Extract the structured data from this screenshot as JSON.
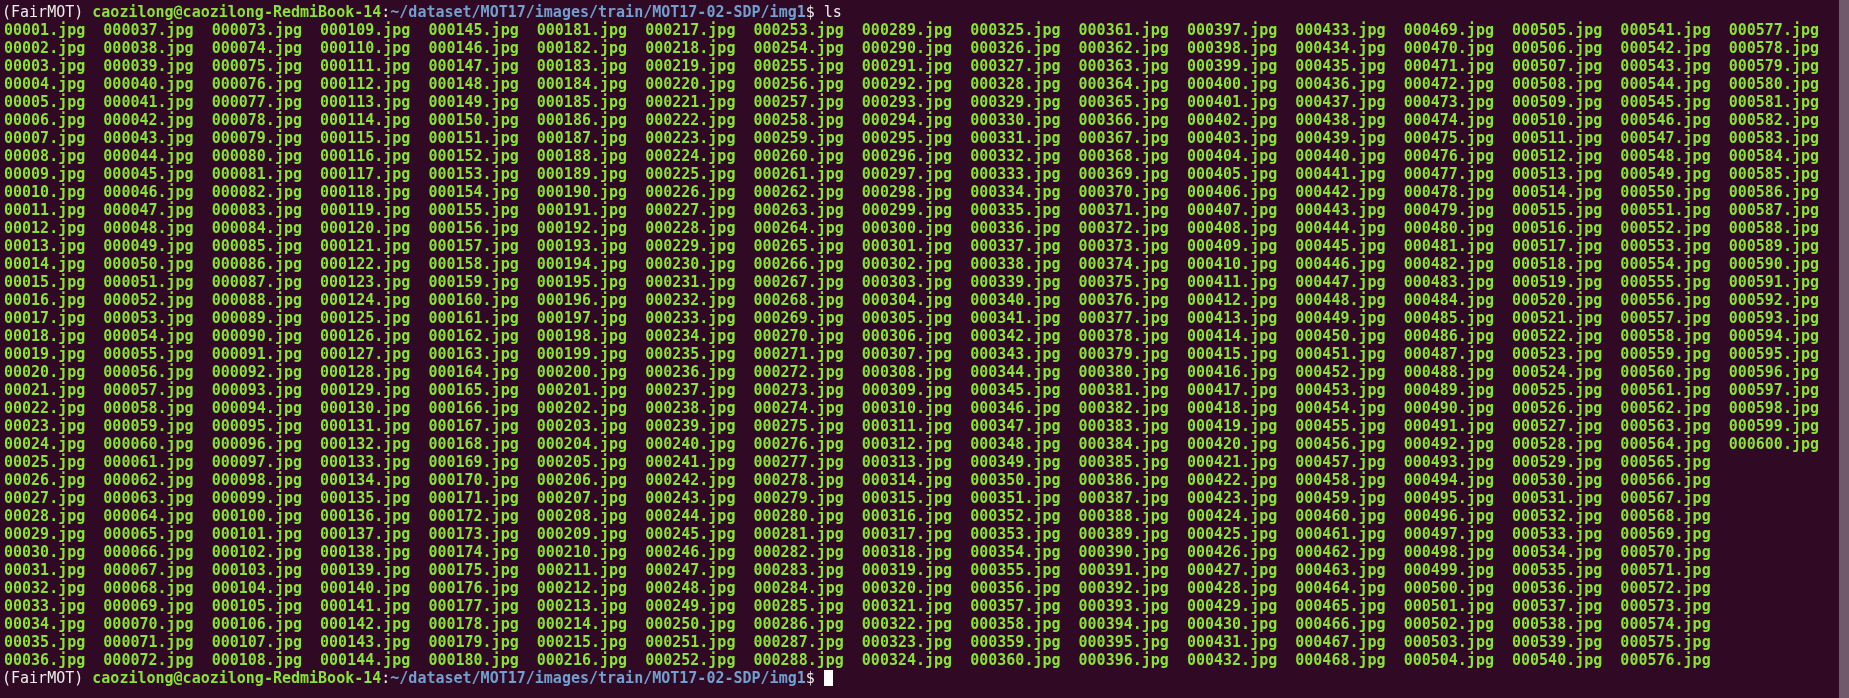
{
  "prompts": [
    {
      "env": "(FairMOT)",
      "user_host": "caozilong@caozilong-RedmiBook-14",
      "separator": ":",
      "path": "~/dataset/MOT17/images/train/MOT17-02-SDP/img1",
      "symbol": "$",
      "command": "ls",
      "cursor": false
    }
  ],
  "listing": {
    "columns": [
      [
        "00001.jpg",
        "00002.jpg",
        "00003.jpg",
        "00004.jpg",
        "00005.jpg",
        "00006.jpg",
        "00007.jpg",
        "00008.jpg",
        "00009.jpg",
        "00010.jpg",
        "00011.jpg",
        "00012.jpg",
        "00013.jpg",
        "00014.jpg",
        "00015.jpg",
        "00016.jpg",
        "00017.jpg",
        "00018.jpg",
        "00019.jpg",
        "00020.jpg",
        "00021.jpg",
        "00022.jpg",
        "00023.jpg",
        "00024.jpg",
        "00025.jpg",
        "00026.jpg",
        "00027.jpg",
        "00028.jpg",
        "00029.jpg",
        "00030.jpg",
        "00031.jpg",
        "00032.jpg",
        "00033.jpg",
        "00034.jpg",
        "00035.jpg",
        "00036.jpg"
      ],
      [
        "000037.jpg",
        "000038.jpg",
        "000039.jpg",
        "000040.jpg",
        "000041.jpg",
        "000042.jpg",
        "000043.jpg",
        "000044.jpg",
        "000045.jpg",
        "000046.jpg",
        "000047.jpg",
        "000048.jpg",
        "000049.jpg",
        "000050.jpg",
        "000051.jpg",
        "000052.jpg",
        "000053.jpg",
        "000054.jpg",
        "000055.jpg",
        "000056.jpg",
        "000057.jpg",
        "000058.jpg",
        "000059.jpg",
        "000060.jpg",
        "000061.jpg",
        "000062.jpg",
        "000063.jpg",
        "000064.jpg",
        "000065.jpg",
        "000066.jpg",
        "000067.jpg",
        "000068.jpg",
        "000069.jpg",
        "000070.jpg",
        "000071.jpg",
        "000072.jpg"
      ],
      [
        "000073.jpg",
        "000074.jpg",
        "000075.jpg",
        "000076.jpg",
        "000077.jpg",
        "000078.jpg",
        "000079.jpg",
        "000080.jpg",
        "000081.jpg",
        "000082.jpg",
        "000083.jpg",
        "000084.jpg",
        "000085.jpg",
        "000086.jpg",
        "000087.jpg",
        "000088.jpg",
        "000089.jpg",
        "000090.jpg",
        "000091.jpg",
        "000092.jpg",
        "000093.jpg",
        "000094.jpg",
        "000095.jpg",
        "000096.jpg",
        "000097.jpg",
        "000098.jpg",
        "000099.jpg",
        "000100.jpg",
        "000101.jpg",
        "000102.jpg",
        "000103.jpg",
        "000104.jpg",
        "000105.jpg",
        "000106.jpg",
        "000107.jpg",
        "000108.jpg"
      ],
      [
        "000109.jpg",
        "000110.jpg",
        "000111.jpg",
        "000112.jpg",
        "000113.jpg",
        "000114.jpg",
        "000115.jpg",
        "000116.jpg",
        "000117.jpg",
        "000118.jpg",
        "000119.jpg",
        "000120.jpg",
        "000121.jpg",
        "000122.jpg",
        "000123.jpg",
        "000124.jpg",
        "000125.jpg",
        "000126.jpg",
        "000127.jpg",
        "000128.jpg",
        "000129.jpg",
        "000130.jpg",
        "000131.jpg",
        "000132.jpg",
        "000133.jpg",
        "000134.jpg",
        "000135.jpg",
        "000136.jpg",
        "000137.jpg",
        "000138.jpg",
        "000139.jpg",
        "000140.jpg",
        "000141.jpg",
        "000142.jpg",
        "000143.jpg",
        "000144.jpg"
      ],
      [
        "000145.jpg",
        "000146.jpg",
        "000147.jpg",
        "000148.jpg",
        "000149.jpg",
        "000150.jpg",
        "000151.jpg",
        "000152.jpg",
        "000153.jpg",
        "000154.jpg",
        "000155.jpg",
        "000156.jpg",
        "000157.jpg",
        "000158.jpg",
        "000159.jpg",
        "000160.jpg",
        "000161.jpg",
        "000162.jpg",
        "000163.jpg",
        "000164.jpg",
        "000165.jpg",
        "000166.jpg",
        "000167.jpg",
        "000168.jpg",
        "000169.jpg",
        "000170.jpg",
        "000171.jpg",
        "000172.jpg",
        "000173.jpg",
        "000174.jpg",
        "000175.jpg",
        "000176.jpg",
        "000177.jpg",
        "000178.jpg",
        "000179.jpg",
        "000180.jpg"
      ],
      [
        "000181.jpg",
        "000182.jpg",
        "000183.jpg",
        "000184.jpg",
        "000185.jpg",
        "000186.jpg",
        "000187.jpg",
        "000188.jpg",
        "000189.jpg",
        "000190.jpg",
        "000191.jpg",
        "000192.jpg",
        "000193.jpg",
        "000194.jpg",
        "000195.jpg",
        "000196.jpg",
        "000197.jpg",
        "000198.jpg",
        "000199.jpg",
        "000200.jpg",
        "000201.jpg",
        "000202.jpg",
        "000203.jpg",
        "000204.jpg",
        "000205.jpg",
        "000206.jpg",
        "000207.jpg",
        "000208.jpg",
        "000209.jpg",
        "000210.jpg",
        "000211.jpg",
        "000212.jpg",
        "000213.jpg",
        "000214.jpg",
        "000215.jpg",
        "000216.jpg"
      ],
      [
        "000217.jpg",
        "000218.jpg",
        "000219.jpg",
        "000220.jpg",
        "000221.jpg",
        "000222.jpg",
        "000223.jpg",
        "000224.jpg",
        "000225.jpg",
        "000226.jpg",
        "000227.jpg",
        "000228.jpg",
        "000229.jpg",
        "000230.jpg",
        "000231.jpg",
        "000232.jpg",
        "000233.jpg",
        "000234.jpg",
        "000235.jpg",
        "000236.jpg",
        "000237.jpg",
        "000238.jpg",
        "000239.jpg",
        "000240.jpg",
        "000241.jpg",
        "000242.jpg",
        "000243.jpg",
        "000244.jpg",
        "000245.jpg",
        "000246.jpg",
        "000247.jpg",
        "000248.jpg",
        "000249.jpg",
        "000250.jpg",
        "000251.jpg",
        "000252.jpg"
      ],
      [
        "000253.jpg",
        "000254.jpg",
        "000255.jpg",
        "000256.jpg",
        "000257.jpg",
        "000258.jpg",
        "000259.jpg",
        "000260.jpg",
        "000261.jpg",
        "000262.jpg",
        "000263.jpg",
        "000264.jpg",
        "000265.jpg",
        "000266.jpg",
        "000267.jpg",
        "000268.jpg",
        "000269.jpg",
        "000270.jpg",
        "000271.jpg",
        "000272.jpg",
        "000273.jpg",
        "000274.jpg",
        "000275.jpg",
        "000276.jpg",
        "000277.jpg",
        "000278.jpg",
        "000279.jpg",
        "000280.jpg",
        "000281.jpg",
        "000282.jpg",
        "000283.jpg",
        "000284.jpg",
        "000285.jpg",
        "000286.jpg",
        "000287.jpg",
        "000288.jpg"
      ],
      [
        "000289.jpg",
        "000290.jpg",
        "000291.jpg",
        "000292.jpg",
        "000293.jpg",
        "000294.jpg",
        "000295.jpg",
        "000296.jpg",
        "000297.jpg",
        "000298.jpg",
        "000299.jpg",
        "000300.jpg",
        "000301.jpg",
        "000302.jpg",
        "000303.jpg",
        "000304.jpg",
        "000305.jpg",
        "000306.jpg",
        "000307.jpg",
        "000308.jpg",
        "000309.jpg",
        "000310.jpg",
        "000311.jpg",
        "000312.jpg",
        "000313.jpg",
        "000314.jpg",
        "000315.jpg",
        "000316.jpg",
        "000317.jpg",
        "000318.jpg",
        "000319.jpg",
        "000320.jpg",
        "000321.jpg",
        "000322.jpg",
        "000323.jpg",
        "000324.jpg"
      ],
      [
        "000325.jpg",
        "000326.jpg",
        "000327.jpg",
        "000328.jpg",
        "000329.jpg",
        "000330.jpg",
        "000331.jpg",
        "000332.jpg",
        "000333.jpg",
        "000334.jpg",
        "000335.jpg",
        "000336.jpg",
        "000337.jpg",
        "000338.jpg",
        "000339.jpg",
        "000340.jpg",
        "000341.jpg",
        "000342.jpg",
        "000343.jpg",
        "000344.jpg",
        "000345.jpg",
        "000346.jpg",
        "000347.jpg",
        "000348.jpg",
        "000349.jpg",
        "000350.jpg",
        "000351.jpg",
        "000352.jpg",
        "000353.jpg",
        "000354.jpg",
        "000355.jpg",
        "000356.jpg",
        "000357.jpg",
        "000358.jpg",
        "000359.jpg",
        "000360.jpg"
      ],
      [
        "000361.jpg",
        "000362.jpg",
        "000363.jpg",
        "000364.jpg",
        "000365.jpg",
        "000366.jpg",
        "000367.jpg",
        "000368.jpg",
        "000369.jpg",
        "000370.jpg",
        "000371.jpg",
        "000372.jpg",
        "000373.jpg",
        "000374.jpg",
        "000375.jpg",
        "000376.jpg",
        "000377.jpg",
        "000378.jpg",
        "000379.jpg",
        "000380.jpg",
        "000381.jpg",
        "000382.jpg",
        "000383.jpg",
        "000384.jpg",
        "000385.jpg",
        "000386.jpg",
        "000387.jpg",
        "000388.jpg",
        "000389.jpg",
        "000390.jpg",
        "000391.jpg",
        "000392.jpg",
        "000393.jpg",
        "000394.jpg",
        "000395.jpg",
        "000396.jpg"
      ],
      [
        "000397.jpg",
        "000398.jpg",
        "000399.jpg",
        "000400.jpg",
        "000401.jpg",
        "000402.jpg",
        "000403.jpg",
        "000404.jpg",
        "000405.jpg",
        "000406.jpg",
        "000407.jpg",
        "000408.jpg",
        "000409.jpg",
        "000410.jpg",
        "000411.jpg",
        "000412.jpg",
        "000413.jpg",
        "000414.jpg",
        "000415.jpg",
        "000416.jpg",
        "000417.jpg",
        "000418.jpg",
        "000419.jpg",
        "000420.jpg",
        "000421.jpg",
        "000422.jpg",
        "000423.jpg",
        "000424.jpg",
        "000425.jpg",
        "000426.jpg",
        "000427.jpg",
        "000428.jpg",
        "000429.jpg",
        "000430.jpg",
        "000431.jpg",
        "000432.jpg"
      ],
      [
        "000433.jpg",
        "000434.jpg",
        "000435.jpg",
        "000436.jpg",
        "000437.jpg",
        "000438.jpg",
        "000439.jpg",
        "000440.jpg",
        "000441.jpg",
        "000442.jpg",
        "000443.jpg",
        "000444.jpg",
        "000445.jpg",
        "000446.jpg",
        "000447.jpg",
        "000448.jpg",
        "000449.jpg",
        "000450.jpg",
        "000451.jpg",
        "000452.jpg",
        "000453.jpg",
        "000454.jpg",
        "000455.jpg",
        "000456.jpg",
        "000457.jpg",
        "000458.jpg",
        "000459.jpg",
        "000460.jpg",
        "000461.jpg",
        "000462.jpg",
        "000463.jpg",
        "000464.jpg",
        "000465.jpg",
        "000466.jpg",
        "000467.jpg",
        "000468.jpg"
      ],
      [
        "000469.jpg",
        "000470.jpg",
        "000471.jpg",
        "000472.jpg",
        "000473.jpg",
        "000474.jpg",
        "000475.jpg",
        "000476.jpg",
        "000477.jpg",
        "000478.jpg",
        "000479.jpg",
        "000480.jpg",
        "000481.jpg",
        "000482.jpg",
        "000483.jpg",
        "000484.jpg",
        "000485.jpg",
        "000486.jpg",
        "000487.jpg",
        "000488.jpg",
        "000489.jpg",
        "000490.jpg",
        "000491.jpg",
        "000492.jpg",
        "000493.jpg",
        "000494.jpg",
        "000495.jpg",
        "000496.jpg",
        "000497.jpg",
        "000498.jpg",
        "000499.jpg",
        "000500.jpg",
        "000501.jpg",
        "000502.jpg",
        "000503.jpg",
        "000504.jpg"
      ],
      [
        "000505.jpg",
        "000506.jpg",
        "000507.jpg",
        "000508.jpg",
        "000509.jpg",
        "000510.jpg",
        "000511.jpg",
        "000512.jpg",
        "000513.jpg",
        "000514.jpg",
        "000515.jpg",
        "000516.jpg",
        "000517.jpg",
        "000518.jpg",
        "000519.jpg",
        "000520.jpg",
        "000521.jpg",
        "000522.jpg",
        "000523.jpg",
        "000524.jpg",
        "000525.jpg",
        "000526.jpg",
        "000527.jpg",
        "000528.jpg",
        "000529.jpg",
        "000530.jpg",
        "000531.jpg",
        "000532.jpg",
        "000533.jpg",
        "000534.jpg",
        "000535.jpg",
        "000536.jpg",
        "000537.jpg",
        "000538.jpg",
        "000539.jpg",
        "000540.jpg"
      ],
      [
        "000541.jpg",
        "000542.jpg",
        "000543.jpg",
        "000544.jpg",
        "000545.jpg",
        "000546.jpg",
        "000547.jpg",
        "000548.jpg",
        "000549.jpg",
        "000550.jpg",
        "000551.jpg",
        "000552.jpg",
        "000553.jpg",
        "000554.jpg",
        "000555.jpg",
        "000556.jpg",
        "000557.jpg",
        "000558.jpg",
        "000559.jpg",
        "000560.jpg",
        "000561.jpg",
        "000562.jpg",
        "000563.jpg",
        "000564.jpg",
        "000565.jpg",
        "000566.jpg",
        "000567.jpg",
        "000568.jpg",
        "000569.jpg",
        "000570.jpg",
        "000571.jpg",
        "000572.jpg",
        "000573.jpg",
        "000574.jpg",
        "000575.jpg",
        "000576.jpg"
      ],
      [
        "000577.jpg",
        "000578.jpg",
        "000579.jpg",
        "000580.jpg",
        "000581.jpg",
        "000582.jpg",
        "000583.jpg",
        "000584.jpg",
        "000585.jpg",
        "000586.jpg",
        "000587.jpg",
        "000588.jpg",
        "000589.jpg",
        "000590.jpg",
        "000591.jpg",
        "000592.jpg",
        "000593.jpg",
        "000594.jpg",
        "000595.jpg",
        "000596.jpg",
        "000597.jpg",
        "000598.jpg",
        "000599.jpg",
        "000600.jpg"
      ]
    ]
  },
  "final_prompt": {
    "env": "(FairMOT)",
    "user_host": "caozilong@caozilong-RedmiBook-14",
    "separator": ":",
    "path": "~/dataset/MOT17/images/train/MOT17-02-SDP/img1",
    "symbol": "$",
    "cursor": true
  }
}
